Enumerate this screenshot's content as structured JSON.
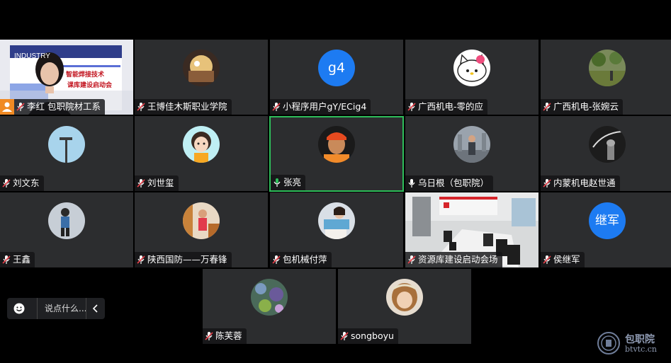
{
  "participants": [
    {
      "name": "李红 包职院材工系",
      "avatar_type": "video",
      "mic": "on",
      "presenter": true,
      "slide_text": "INDUSTRY",
      "slide_line1": "智能焊接技术",
      "slide_line2": "课库建设启动会"
    },
    {
      "name": "王博佳木斯职业学院",
      "avatar_type": "image",
      "mic": "muted"
    },
    {
      "name": "小程序用户gY/ECig4",
      "avatar_type": "text",
      "avatar_text": "g4",
      "mic": "muted"
    },
    {
      "name": "广西机电-零的应",
      "avatar_type": "image",
      "mic": "muted"
    },
    {
      "name": "广西机电-张婉云",
      "avatar_type": "image",
      "mic": "muted"
    },
    {
      "name": "刘文东",
      "avatar_type": "image",
      "mic": "muted"
    },
    {
      "name": "刘世玺",
      "avatar_type": "image",
      "mic": "muted"
    },
    {
      "name": "张亮",
      "avatar_type": "image",
      "mic": "speaking"
    },
    {
      "name": "乌日根（包职院）",
      "avatar_type": "image",
      "mic": "on"
    },
    {
      "name": "内蒙机电赵世通",
      "avatar_type": "image",
      "mic": "muted"
    },
    {
      "name": "王鑫",
      "avatar_type": "image",
      "mic": "muted"
    },
    {
      "name": "陕西国防——万春锋",
      "avatar_type": "image",
      "mic": "muted"
    },
    {
      "name": "包机械付萍",
      "avatar_type": "image",
      "mic": "muted"
    },
    {
      "name": "资源库建设启动会场",
      "avatar_type": "video",
      "mic": "muted"
    },
    {
      "name": "侯继军",
      "avatar_type": "text",
      "avatar_text": "继军",
      "mic": "muted"
    },
    {
      "name": "陈芙蓉",
      "avatar_type": "image",
      "mic": "muted"
    },
    {
      "name": "songboyu",
      "avatar_type": "image",
      "mic": "muted"
    }
  ],
  "chat": {
    "placeholder": "说点什么..."
  },
  "watermark": {
    "line1": "包职院",
    "line2": "btvtc.cn"
  },
  "colors": {
    "tile_bg": "#2c2d2f",
    "speaking_border": "#2ebd5a",
    "text_avatar": "#1d7bf2",
    "mic_muted": "#e8414b",
    "presenter": "#f08a24"
  }
}
